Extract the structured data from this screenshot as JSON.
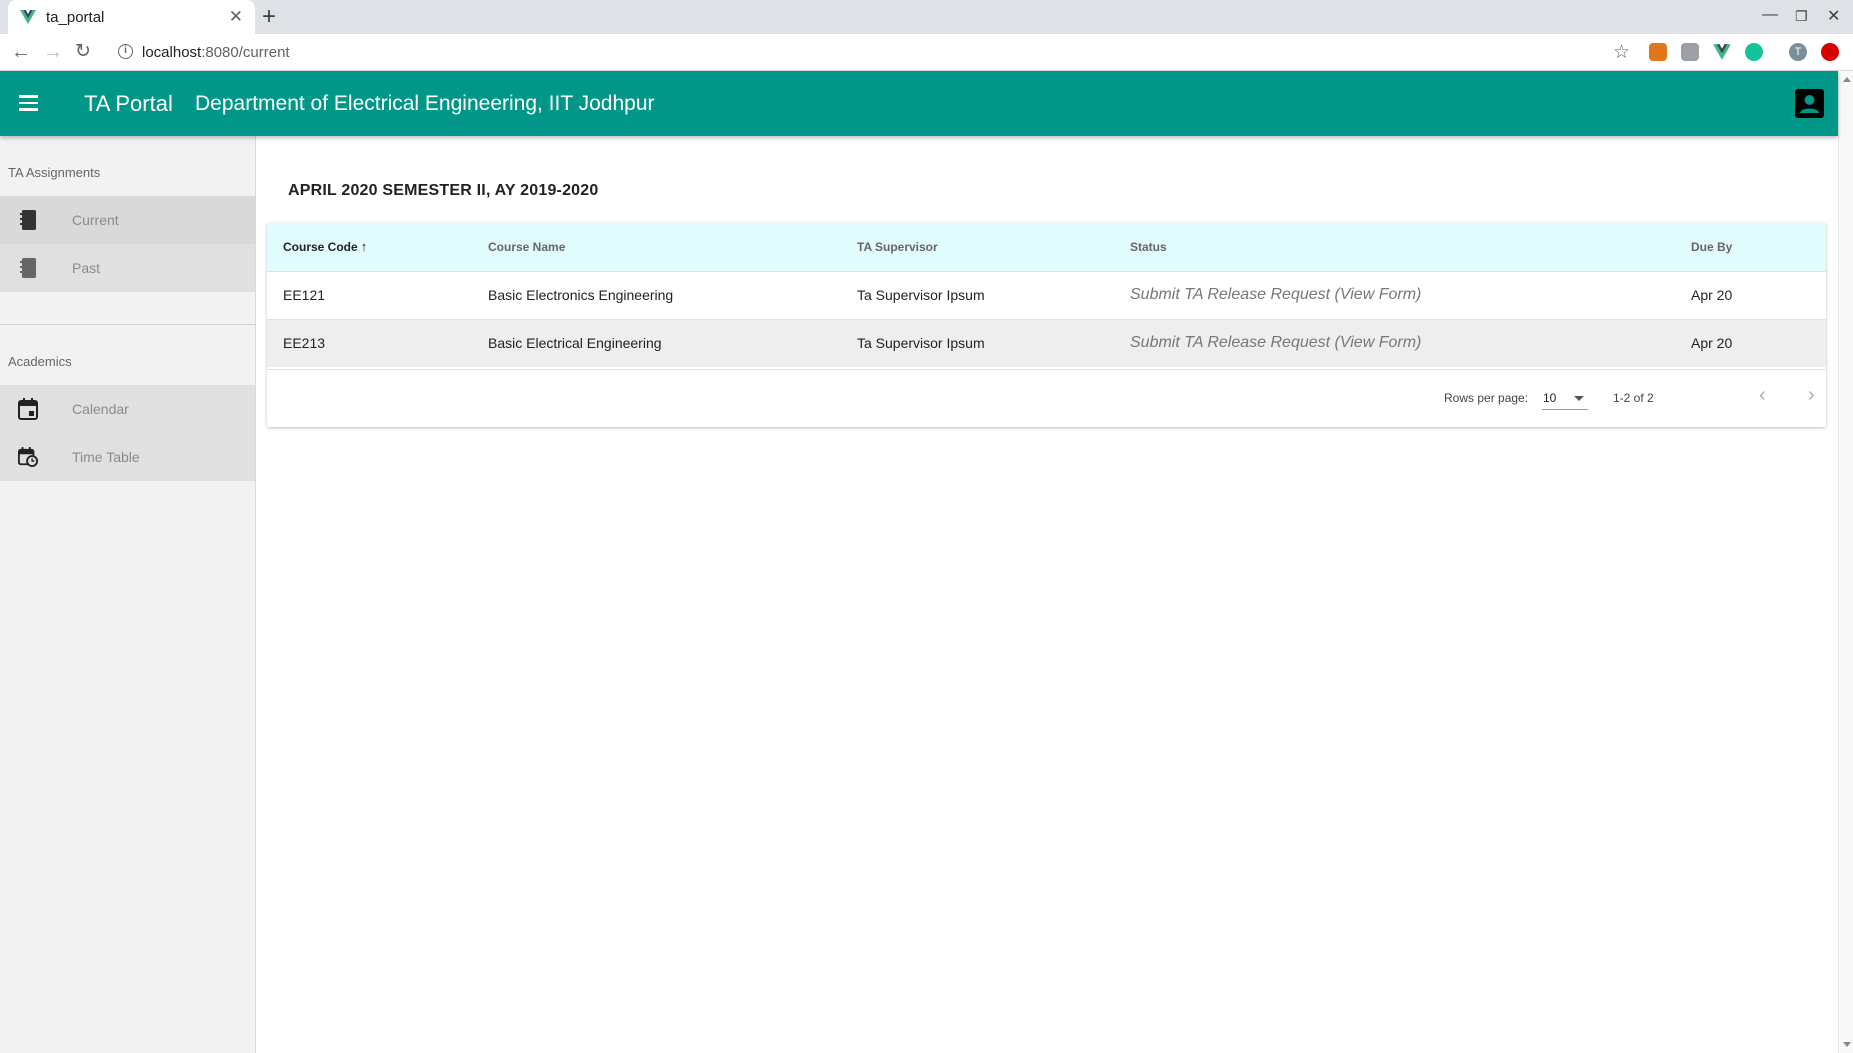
{
  "browser": {
    "tab_title": "ta_portal",
    "url_host": "localhost",
    "url_path": ":8080/current",
    "profile_initial": "T"
  },
  "appbar": {
    "title": "TA Portal",
    "subtitle": "Department of Electrical Engineering, IIT Jodhpur"
  },
  "sidebar": {
    "sections": [
      {
        "header": "TA Assignments",
        "items": [
          {
            "label": "Current",
            "icon": "notebook-icon"
          },
          {
            "label": "Past",
            "icon": "notebook-icon"
          }
        ]
      },
      {
        "header": "Academics",
        "items": [
          {
            "label": "Calendar",
            "icon": "calendar-icon"
          },
          {
            "label": "Time Table",
            "icon": "calendar-clock-icon"
          }
        ]
      }
    ]
  },
  "main": {
    "semester_title": "APRIL 2020 SEMESTER II, AY 2019-2020",
    "table": {
      "headers": [
        "Course Code",
        "Course Name",
        "TA Supervisor",
        "Status",
        "Due By"
      ],
      "sort_arrow": "↑",
      "rows": [
        {
          "code": "EE121",
          "name": "Basic Electronics Engineering",
          "supervisor": "Ta Supervisor Ipsum",
          "status": "Submit TA Release Request (View Form)",
          "due": "Apr 20"
        },
        {
          "code": "EE213",
          "name": "Basic Electrical Engineering",
          "supervisor": "Ta Supervisor Ipsum",
          "status": "Submit TA Release Request (View Form)",
          "due": "Apr 20"
        }
      ]
    },
    "pagination": {
      "rows_per_page_label": "Rows per page:",
      "rows_per_page_value": "10",
      "range": "1-2 of 2"
    }
  },
  "colors": {
    "appbar": "#009688",
    "table_header": "#e0fcfc",
    "sidebar": "#f2f2f2"
  }
}
